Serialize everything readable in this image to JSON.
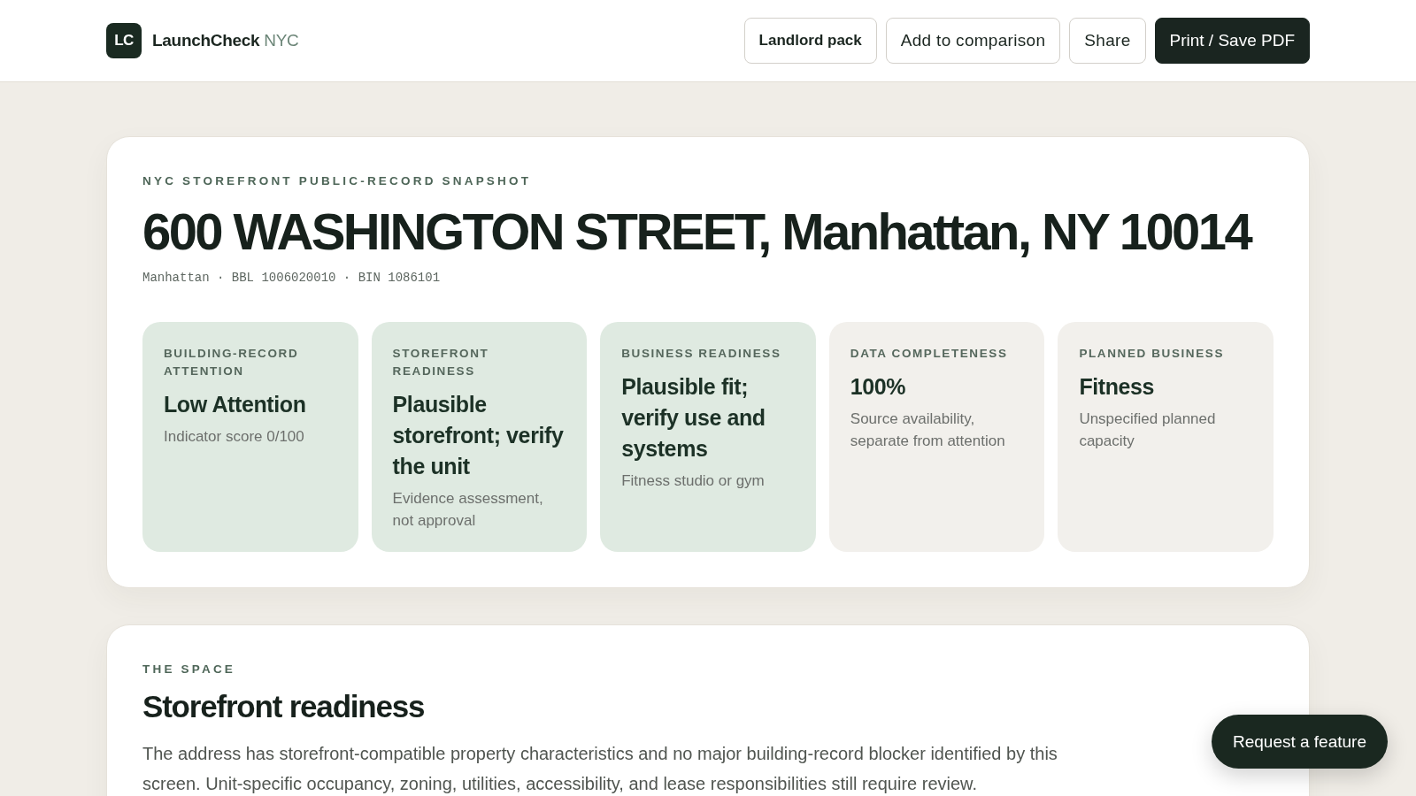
{
  "header": {
    "logo": {
      "mark": "LC",
      "name": "LaunchCheck",
      "suffix": "NYC"
    },
    "actions": [
      {
        "label": "Landlord pack",
        "kind": "emphasis"
      },
      {
        "label": "Add to comparison",
        "kind": "outline"
      },
      {
        "label": "Share",
        "kind": "outline"
      },
      {
        "label": "Print / Save PDF",
        "kind": "primary"
      }
    ]
  },
  "snapshot": {
    "eyebrow": "NYC STOREFRONT PUBLIC-RECORD SNAPSHOT",
    "title": "600 WASHINGTON STREET, Manhattan, NY 10014",
    "meta": "Manhattan · BBL 1006020010 · BIN 1086101",
    "metrics": [
      {
        "label": "BUILDING-RECORD ATTENTION",
        "value": "Low Attention",
        "note": "Indicator score 0/100",
        "color": "#dfeae1"
      },
      {
        "label": "STOREFRONT READINESS",
        "value": "Plausible storefront; verify the unit",
        "note": "Evidence assessment, not approval",
        "color": "#dfeae1"
      },
      {
        "label": "BUSINESS READINESS",
        "value": "Plausible fit; verify use and systems",
        "note": "Fitness studio or gym",
        "color": "#dfeae1"
      },
      {
        "label": "DATA COMPLETENESS",
        "value": "100%",
        "note": "Source availability, separate from attention",
        "color": "#f2f0ec"
      },
      {
        "label": "PLANNED BUSINESS",
        "value": "Fitness",
        "note": "Unspecified planned capacity",
        "color": "#f2f0ec"
      }
    ]
  },
  "space": {
    "eyebrow": "THE SPACE",
    "title": "Storefront readiness",
    "body": "The address has storefront-compatible property characteristics and no major building-record blocker identified by this screen. Unit-specific occupancy, zoning, utilities, accessibility, and lease responsibilities still require review."
  },
  "feedback_button": {
    "label": "Request a feature"
  }
}
